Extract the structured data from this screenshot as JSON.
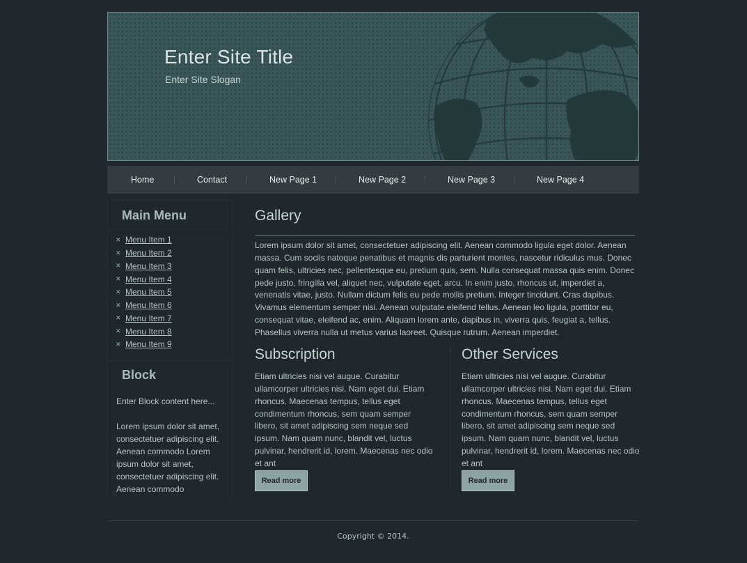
{
  "header": {
    "site_title": "Enter Site Title",
    "site_slogan": "Enter Site Slogan"
  },
  "nav": {
    "items": [
      "Home",
      "Contact",
      "New Page 1",
      "New Page 2",
      "New Page 3",
      "New Page 4"
    ]
  },
  "sidebar": {
    "main_menu_title": "Main Menu",
    "menu_items": [
      "Menu Item 1",
      "Menu Item 2",
      "Menu Item 3",
      "Menu Item 4",
      "Menu Item 5",
      "Menu Item 6",
      "Menu Item 7",
      "Menu Item 8",
      "Menu Item 9"
    ],
    "block_title": "Block",
    "block_intro": "Enter Block content here...",
    "block_text": "Lorem ipsum dolor sit amet, consectetuer adipiscing elit. Aenean commodo Lorem ipsum dolor sit amet, consectetuer adipiscing elit. Aenean commodo"
  },
  "main": {
    "gallery_title": "Gallery",
    "gallery_text": "Lorem ipsum dolor sit amet, consectetuer adipiscing elit. Aenean commodo ligula eget dolor. Aenean massa. Cum sociis natoque penatibus et magnis dis parturient montes, nascetur ridiculus mus. Donec quam felis, ultricies nec, pellentesque eu, pretium quis, sem. Nulla consequat massa quis enim. Donec pede justo, fringilla vel, aliquet nec, vulputate eget, arcu. In enim justo, rhoncus ut, imperdiet a, venenatis vitae, justo. Nullam dictum felis eu pede mollis pretium. Integer tincidunt. Cras dapibus. Vivamus elementum semper nisi. Aenean vulputate eleifend tellus. Aenean leo ligula, porttitor eu, consequat vitae, eleifend ac, enim. Aliquam lorem ante, dapibus in, viverra quis, feugiat a, tellus. Phasellus viverra nulla ut metus varius laoreet. Quisque rutrum. Aenean imperdiet.",
    "subscription_title": "Subscription",
    "subscription_text": "Etiam ultricies nisi vel augue. Curabitur ullamcorper ultricies nisi. Nam eget dui. Etiam rhoncus. Maecenas tempus, tellus eget condimentum rhoncus, sem quam semper libero, sit amet adipiscing sem neque sed ipsum. Nam quam nunc, blandit vel, luctus pulvinar, hendrerit id, lorem. Maecenas nec odio et ant",
    "services_title": "Other Services",
    "services_text": "Etiam ultricies nisi vel augue. Curabitur ullamcorper ultricies nisi. Nam eget dui. Etiam rhoncus. Maecenas tempus, tellus eget condimentum rhoncus, sem quam semper libero, sit amet adipiscing sem neque sed ipsum. Nam quam nunc, blandit vel, luctus pulvinar, hendrerit id, lorem. Maecenas nec odio et ant",
    "read_more_label": "Read more"
  },
  "footer": {
    "copyright": "Copyright © 2014."
  }
}
